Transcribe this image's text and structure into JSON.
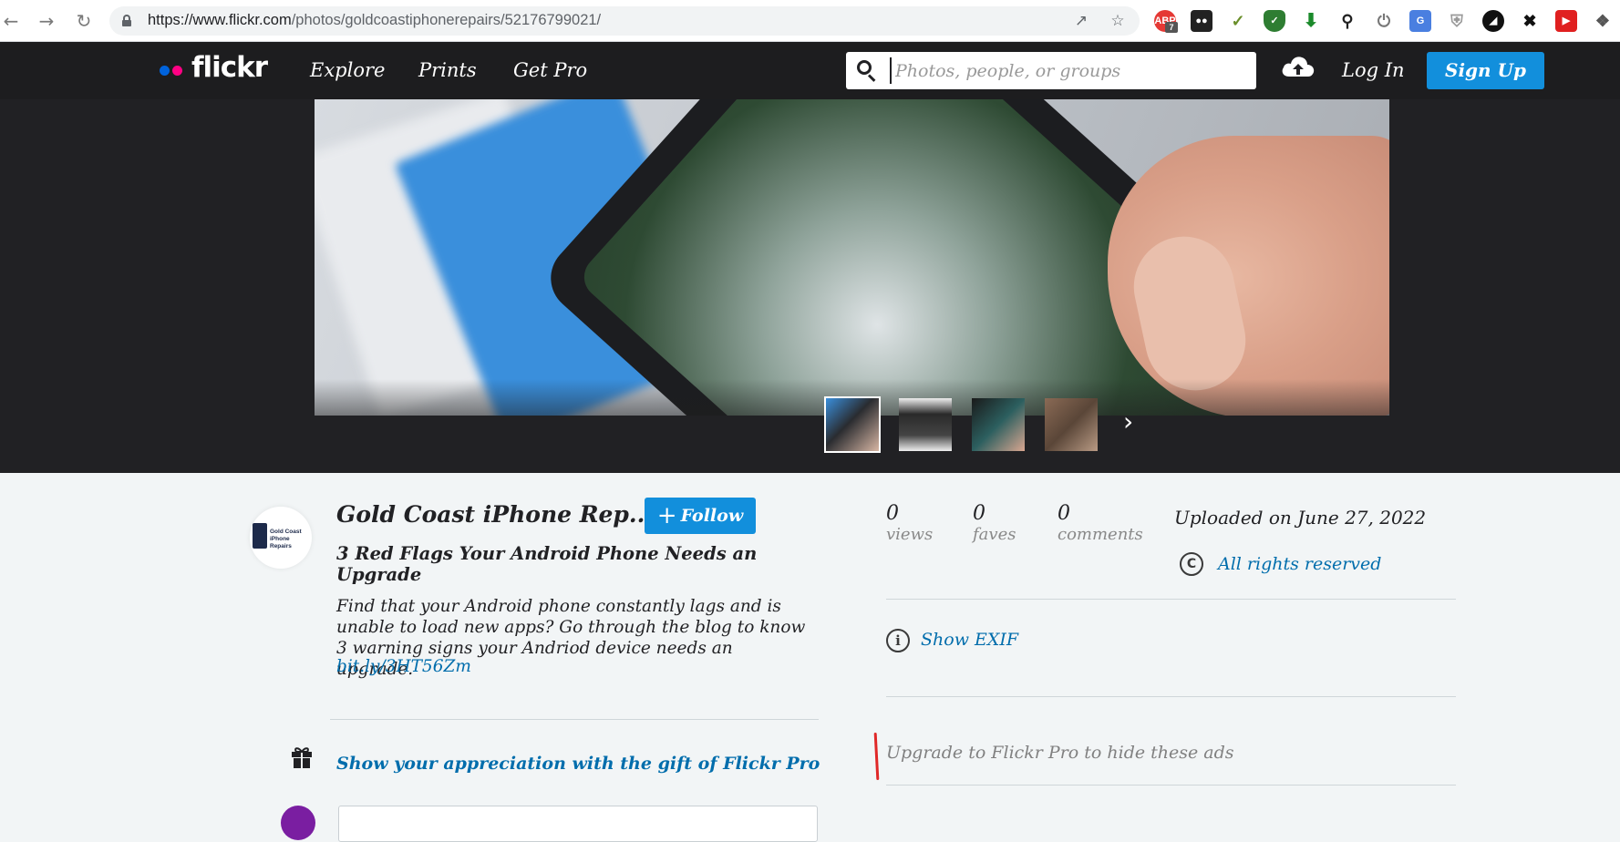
{
  "browser": {
    "url_host": "https://www.flickr.com",
    "url_path": "/photos/goldcoastiphonerepairs/52176799021/",
    "abp_badge": "7"
  },
  "header": {
    "logo": "flickr",
    "nav": [
      "Explore",
      "Prints",
      "Get Pro"
    ],
    "search_placeholder": "Photos, people, or groups",
    "login": "Log In",
    "signup": "Sign Up",
    "colors": {
      "blue_dot": "#0063dc",
      "pink_dot": "#ff0084",
      "button": "#128fdc"
    }
  },
  "photo": {
    "thumbnails": [
      "current-photo",
      "phone-teardown",
      "phone-repair",
      "repair-bench"
    ],
    "active_index": 0
  },
  "owner": {
    "name": "Gold Coast iPhone Rep...",
    "avatar_text": "Gold Coast iPhone Repairs",
    "follow": "Follow"
  },
  "details": {
    "title": "3 Red Flags Your Android Phone Needs an Upgrade",
    "description": "Find that your Android phone constantly lags and is unable to load new apps? Go through the blog to know 3 warning signs your Andriod device needs an upgrade.",
    "link": "bit.ly/3HT56Zm",
    "gift": "Show your appreciation with the gift of Flickr Pro"
  },
  "stats": {
    "views": {
      "num": "0",
      "label": "views"
    },
    "faves": {
      "num": "0",
      "label": "faves"
    },
    "comments": {
      "num": "0",
      "label": "comments"
    },
    "uploaded": "Uploaded on June 27, 2022",
    "rights": "All rights reserved",
    "exif": "Show EXIF",
    "ads": "Upgrade to Flickr Pro to hide these ads"
  }
}
